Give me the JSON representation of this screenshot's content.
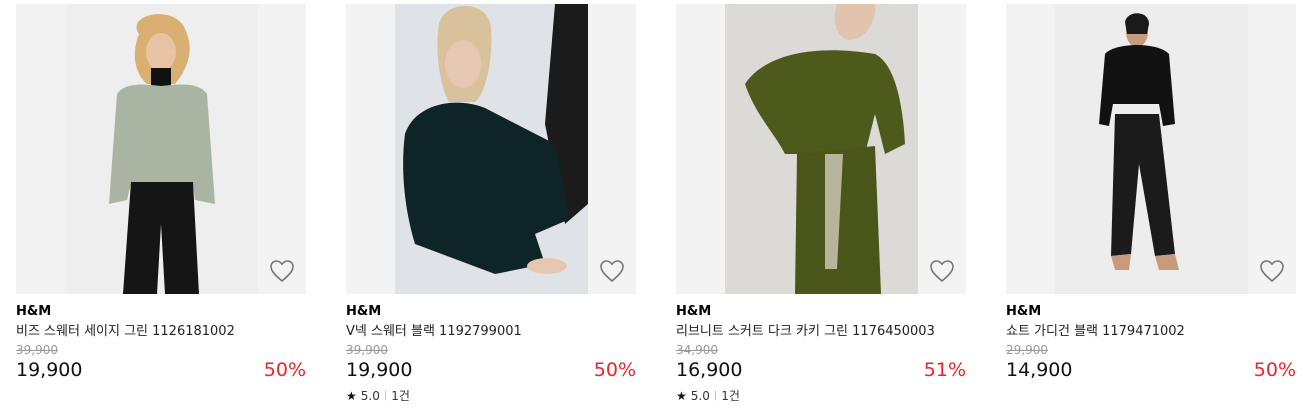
{
  "products": [
    {
      "brand": "H&M",
      "name": "비즈 스웨터 세이지 그린 1126181002",
      "original_price": "39,900",
      "price": "19,900",
      "discount": "50%",
      "rating": null,
      "review_count": null
    },
    {
      "brand": "H&M",
      "name": "V넥 스웨터 블랙 1192799001",
      "original_price": "39,900",
      "price": "19,900",
      "discount": "50%",
      "rating": "5.0",
      "review_count": "1건"
    },
    {
      "brand": "H&M",
      "name": "리브니트 스커트 다크 카키 그린 1176450003",
      "original_price": "34,900",
      "price": "16,900",
      "discount": "51%",
      "rating": "5.0",
      "review_count": "1건"
    },
    {
      "brand": "H&M",
      "name": "쇼트 가디건 블랙 1179471002",
      "original_price": "29,900",
      "price": "14,900",
      "discount": "50%",
      "rating": null,
      "review_count": null
    }
  ],
  "icons": {
    "wishlist": "heart-outline-icon",
    "rating": "star-icon"
  },
  "colors": {
    "discount": "#e8262c",
    "image_bg": "#f3f3f3"
  }
}
